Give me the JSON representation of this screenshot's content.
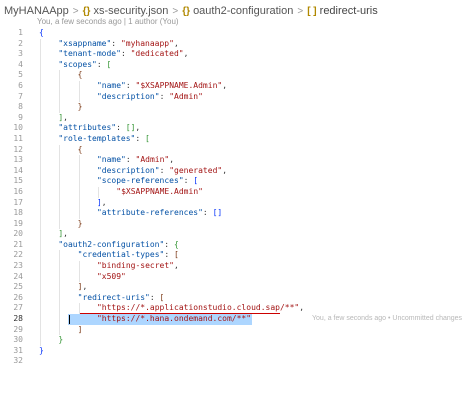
{
  "breadcrumb": {
    "items": [
      "MyHANAApp",
      "xs-security.json",
      "oauth2-configuration",
      "redirect-uris"
    ],
    "separator": ">",
    "icons": [
      "",
      "braces-icon",
      "braces-icon",
      "brackets-icon"
    ]
  },
  "blame_header": "You, a few seconds ago | 1 author (You)",
  "inline_blame": "You, a few seconds ago • Uncommitted changes",
  "active_line": 28,
  "colors": {
    "key": "#0451a5",
    "string": "#a31515",
    "bracket_level1": "#0431fa",
    "bracket_level2": "#319331",
    "bracket_level3": "#7b3814",
    "selection": "#add6ff"
  },
  "lines": [
    {
      "n": "1",
      "text": "{"
    },
    {
      "n": "2",
      "text": "    \"xsappname\": \"myhanaapp\","
    },
    {
      "n": "3",
      "text": "    \"tenant-mode\": \"dedicated\","
    },
    {
      "n": "4",
      "text": "    \"scopes\": ["
    },
    {
      "n": "5",
      "text": "        {"
    },
    {
      "n": "6",
      "text": "            \"name\": \"$XSAPPNAME.Admin\","
    },
    {
      "n": "7",
      "text": "            \"description\": \"Admin\""
    },
    {
      "n": "8",
      "text": "        }"
    },
    {
      "n": "9",
      "text": "    ],"
    },
    {
      "n": "10",
      "text": "    \"attributes\": [],"
    },
    {
      "n": "11",
      "text": "    \"role-templates\": ["
    },
    {
      "n": "12",
      "text": "        {"
    },
    {
      "n": "13",
      "text": "            \"name\": \"Admin\","
    },
    {
      "n": "14",
      "text": "            \"description\": \"generated\","
    },
    {
      "n": "15",
      "text": "            \"scope-references\": ["
    },
    {
      "n": "16",
      "text": "                \"$XSAPPNAME.Admin\""
    },
    {
      "n": "17",
      "text": "            ],"
    },
    {
      "n": "18",
      "text": "            \"attribute-references\": []"
    },
    {
      "n": "19",
      "text": "        }"
    },
    {
      "n": "20",
      "text": "    ],"
    },
    {
      "n": "21",
      "text": "    \"oauth2-configuration\": {"
    },
    {
      "n": "22",
      "text": "        \"credential-types\": ["
    },
    {
      "n": "23",
      "text": "            \"binding-secret\","
    },
    {
      "n": "24",
      "text": "            \"x509\""
    },
    {
      "n": "25",
      "text": "        ],"
    },
    {
      "n": "26",
      "text": "        \"redirect-uris\": ["
    },
    {
      "n": "27",
      "text": "            \"https://*.applicationstudio.cloud.sap/**\","
    },
    {
      "n": "28",
      "text": "            \"https://*.hana.ondemand.com/**\""
    },
    {
      "n": "29",
      "text": "        ]"
    },
    {
      "n": "30",
      "text": "    }"
    },
    {
      "n": "31",
      "text": "}"
    },
    {
      "n": "32",
      "text": ""
    }
  ]
}
